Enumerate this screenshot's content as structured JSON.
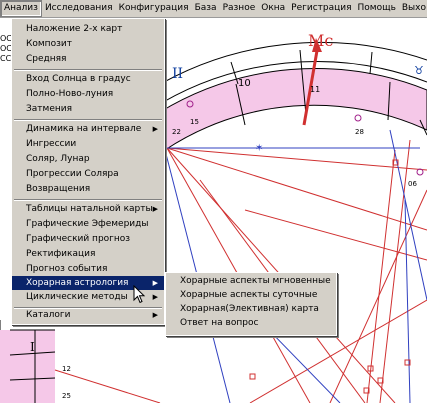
{
  "menubar": {
    "items": [
      "Анализ",
      "Исследования",
      "Конфигурация",
      "База",
      "Разное",
      "Окна",
      "Регистрация",
      "Помощь",
      "Выхо"
    ]
  },
  "left_text": [
    "ОС",
    "ОС",
    "СС"
  ],
  "analysis_menu": {
    "items": [
      {
        "label": "Наложение 2-х карт"
      },
      {
        "label": "Композит"
      },
      {
        "label": "Средняя"
      },
      {
        "label": "Вход Солнца в градус"
      },
      {
        "label": "Полно-Ново-луния"
      },
      {
        "label": "Затмения"
      },
      {
        "label": "Динамика на интервале"
      },
      {
        "label": "Ингрессии"
      },
      {
        "label": "Соляр, Лунар"
      },
      {
        "label": "Прогрессии Соляра"
      },
      {
        "label": "Возвращения"
      },
      {
        "label": "Таблицы натальной карты"
      },
      {
        "label": "Графические Эфемериды"
      },
      {
        "label": "Графический прогноз"
      },
      {
        "label": "Ректификация"
      },
      {
        "label": "Прогноз события"
      },
      {
        "label": "Хорарная астрология"
      },
      {
        "label": "Циклические методы"
      },
      {
        "label": "Каталоги"
      }
    ]
  },
  "horary_submenu": {
    "items": [
      {
        "label": "Хорарные аспекты мгновенные"
      },
      {
        "label": "Хорарные аспекты суточные"
      },
      {
        "label": "Хорарная(Элективная) карта"
      },
      {
        "label": "Ответ на вопрос"
      }
    ]
  },
  "chart_labels": {
    "mc": "Mc",
    "house_11": "11",
    "house_10": "10",
    "num_15": "15",
    "num_22": "22",
    "num_28": "28",
    "num_06": "06",
    "num_12": "12",
    "num_25": "25",
    "roman_i": "I"
  },
  "colors": {
    "menu_bg": "#d4d0c8",
    "highlight": "#0a246a",
    "aspect_red": "#d03030",
    "aspect_blue": "#3040c0",
    "ring_pink": "#f5c8e8"
  }
}
